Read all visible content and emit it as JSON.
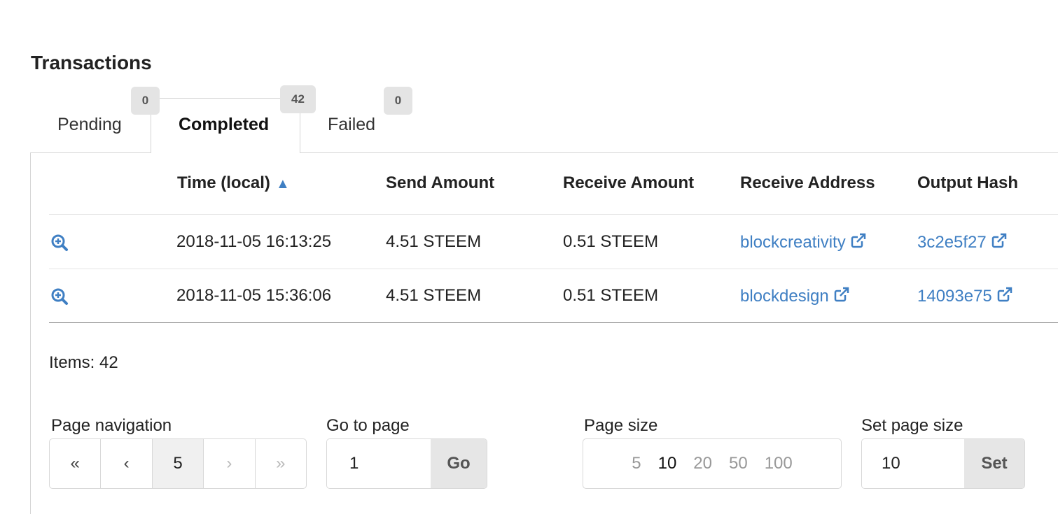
{
  "title": "Transactions",
  "tabs": [
    {
      "label": "Pending",
      "count": "0"
    },
    {
      "label": "Completed",
      "count": "42"
    },
    {
      "label": "Failed",
      "count": "0"
    }
  ],
  "table": {
    "headers": {
      "time": "Time (local)",
      "sort_indicator": "▲",
      "send": "Send Amount",
      "receive": "Receive Amount",
      "address": "Receive Address",
      "hash": "Output Hash"
    },
    "rows": [
      {
        "time": "2018-11-05 16:13:25",
        "send": "4.51 STEEM",
        "receive": "0.51 STEEM",
        "address": "blockcreativity",
        "hash": "3c2e5f27"
      },
      {
        "time": "2018-11-05 15:36:06",
        "send": "4.51 STEEM",
        "receive": "0.51 STEEM",
        "address": "blockdesign",
        "hash": "14093e75"
      }
    ]
  },
  "items": "Items: 42",
  "pagination": {
    "label": "Page navigation",
    "first": "«",
    "prev": "‹",
    "current": "5",
    "next": "›",
    "last": "»"
  },
  "goto": {
    "label": "Go to page",
    "value": "1",
    "button": "Go"
  },
  "page_size": {
    "label": "Page size",
    "options": [
      "5",
      "10",
      "20",
      "50",
      "100"
    ],
    "selected": "10"
  },
  "set_size": {
    "label": "Set page size",
    "value": "10",
    "button": "Set"
  },
  "icons": {
    "zoom": "zoom-in-icon",
    "external": "external-link-icon"
  },
  "colors": {
    "link": "#3f7fc3",
    "badge": "#e4e4e4",
    "border": "#d4d4d4"
  }
}
